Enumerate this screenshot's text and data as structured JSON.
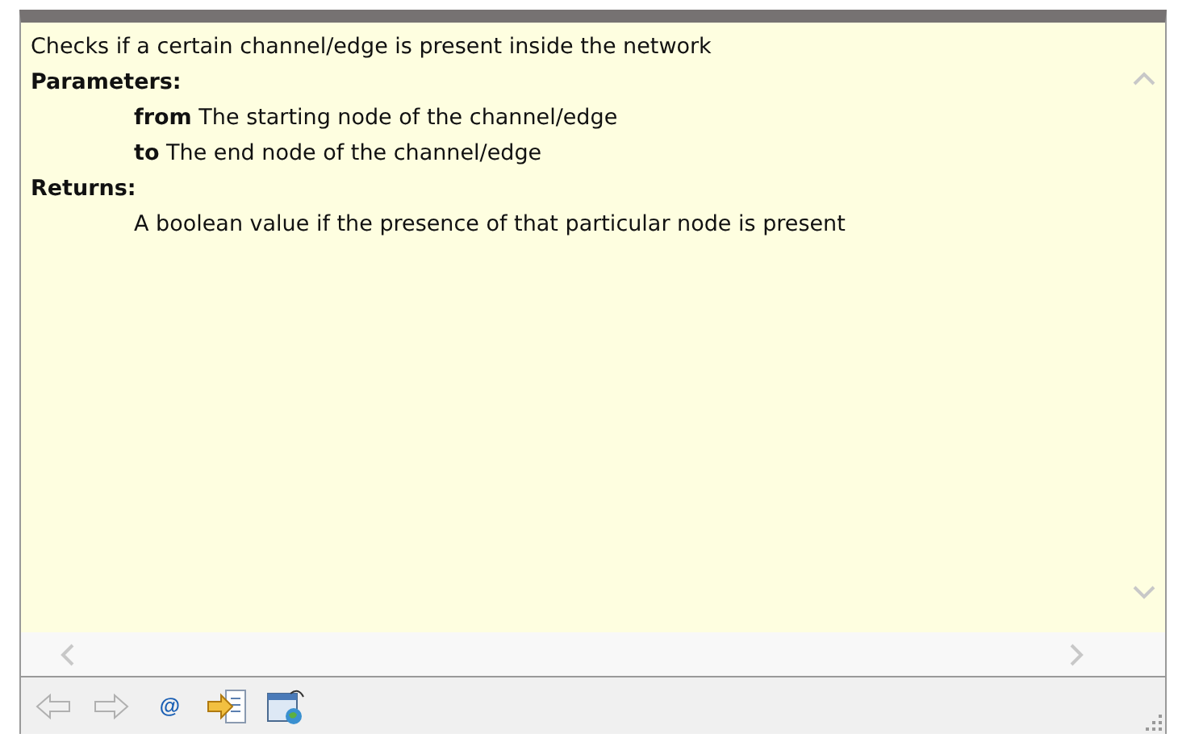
{
  "doc": {
    "summary": "Checks if a certain channel/edge is present inside the network",
    "sections": [
      {
        "heading": "Parameters:",
        "items": [
          "**from** The starting node of the channel/edge",
          "**to** The end node of the channel/edge"
        ]
      },
      {
        "heading": "Returns:",
        "items": [
          "A boolean value if the presence of that particular node is present"
        ]
      }
    ]
  },
  "toolbar": [
    {
      "kind": "back",
      "disabled": true
    },
    {
      "kind": "forward",
      "disabled": true
    },
    {
      "kind": "text",
      "label": "@",
      "disabled": false
    },
    {
      "kind": "open-declaration",
      "disabled": false
    },
    {
      "kind": "browser",
      "disabled": false
    }
  ]
}
